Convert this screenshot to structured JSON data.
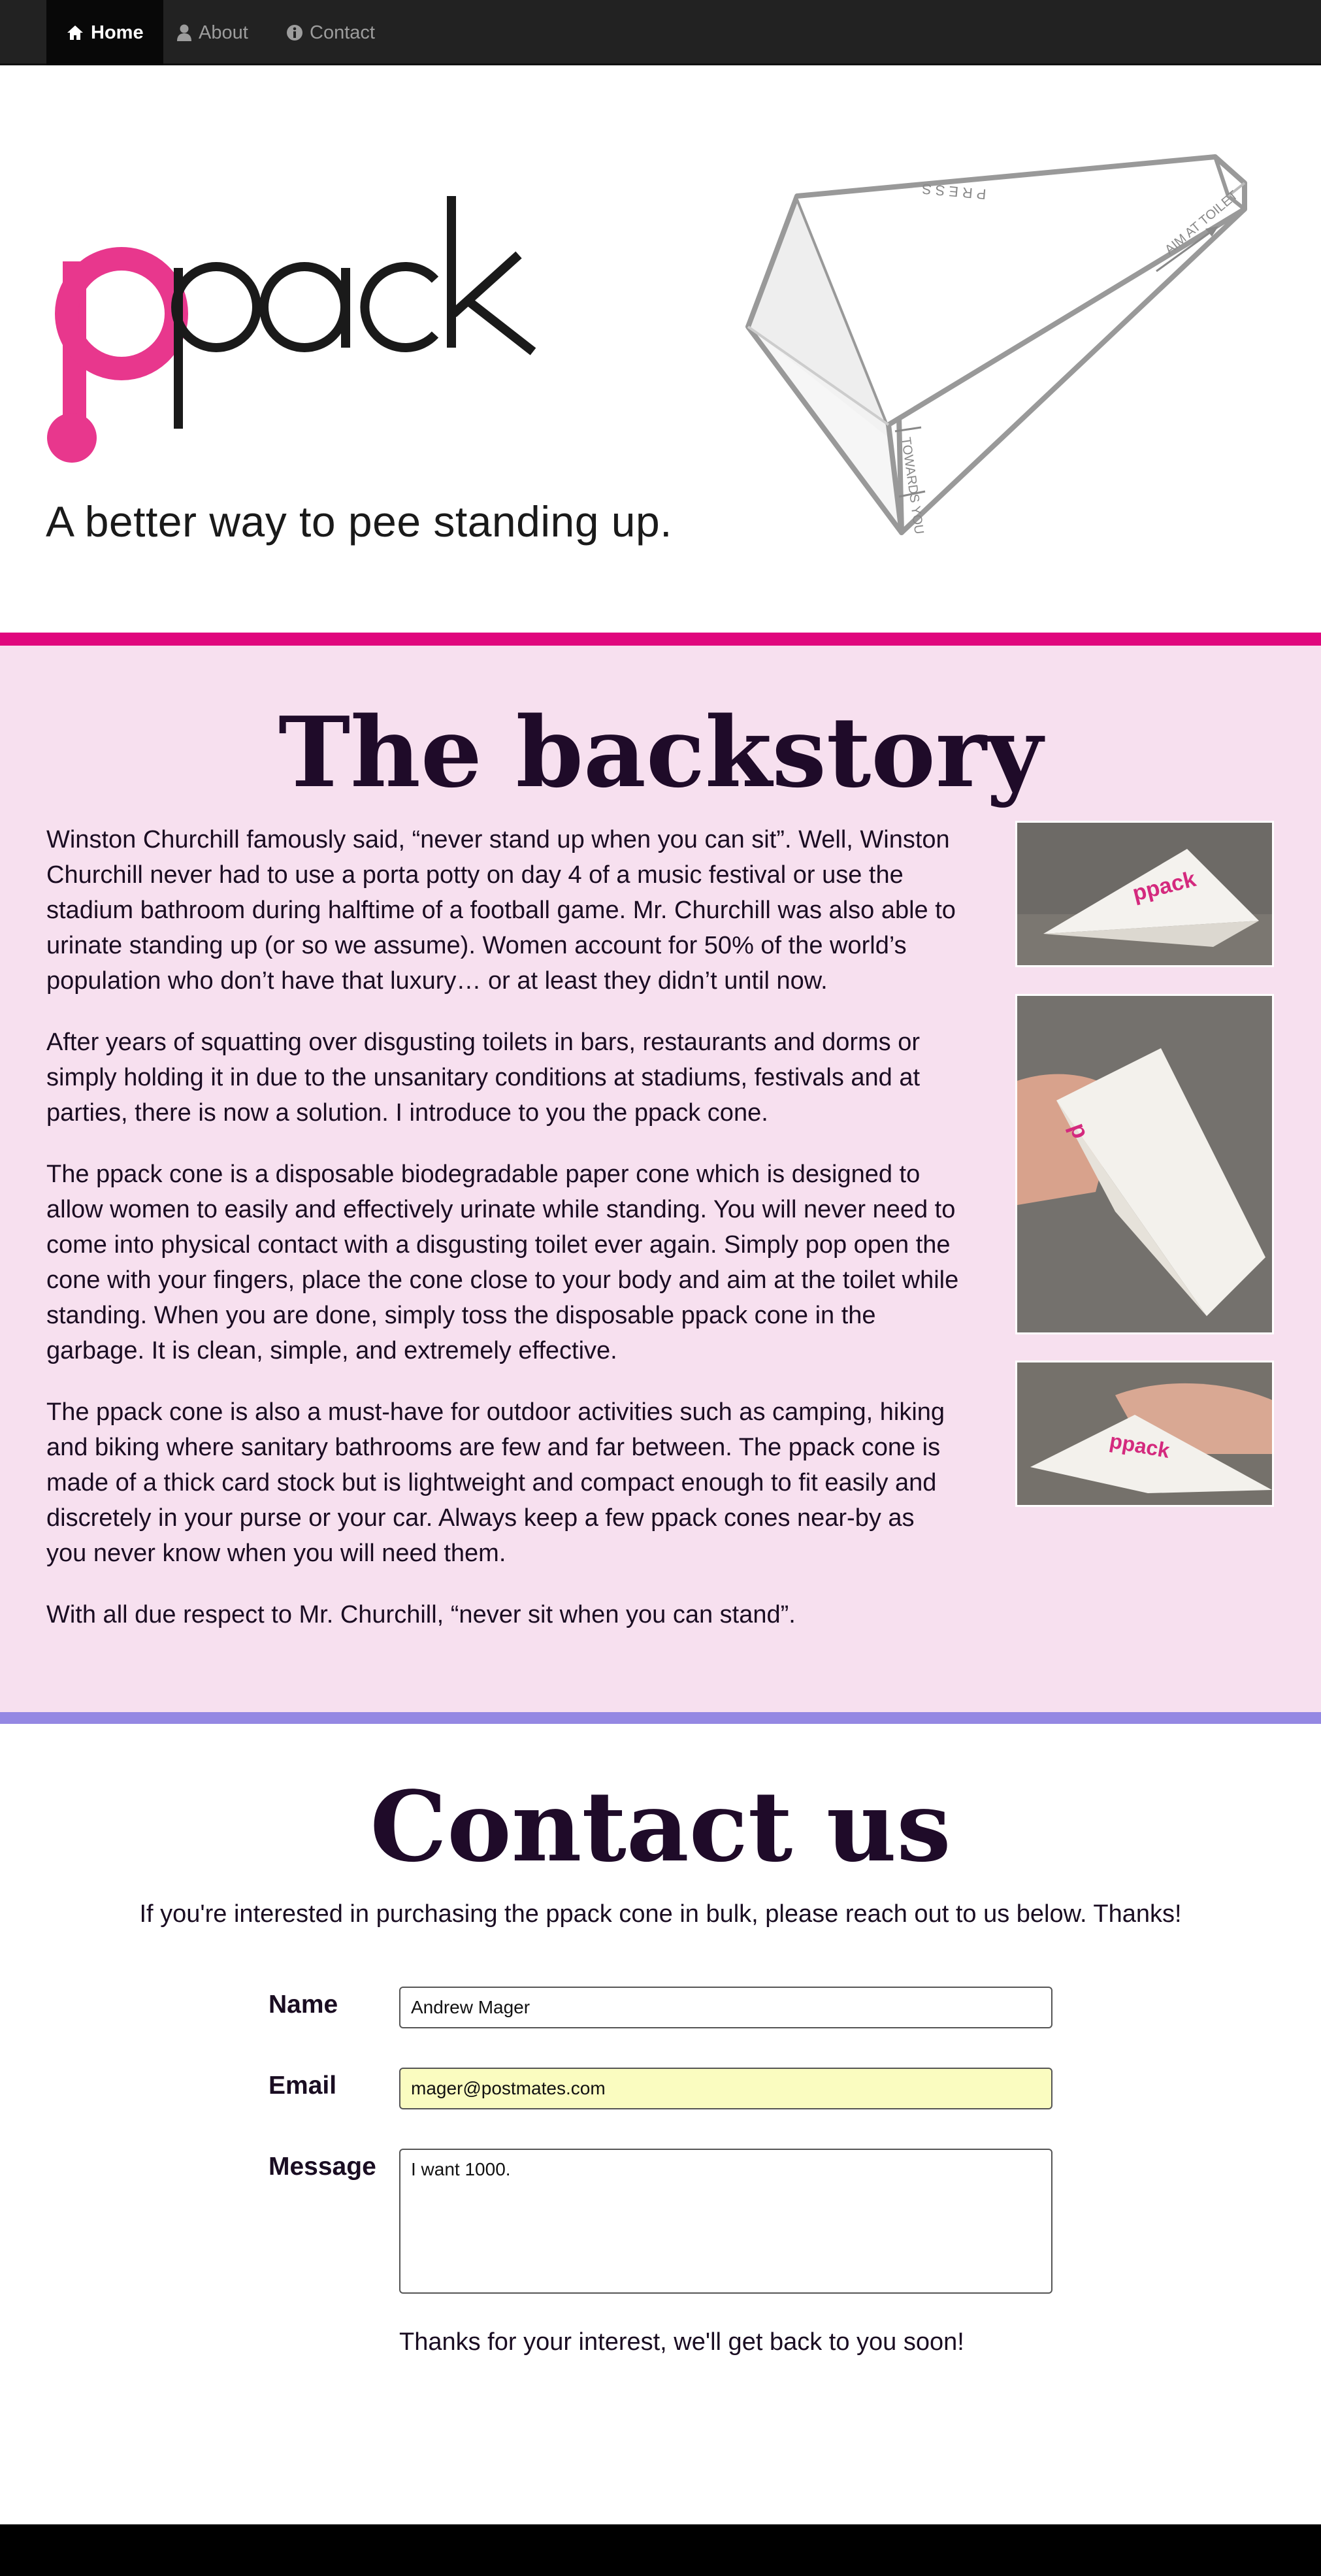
{
  "nav": {
    "items": [
      {
        "label": "Home",
        "icon": "home-icon",
        "active": true
      },
      {
        "label": "About",
        "icon": "user-icon",
        "active": false
      },
      {
        "label": "Contact",
        "icon": "info-circle-icon",
        "active": false
      }
    ]
  },
  "hero": {
    "logo_text": "ppack",
    "tagline": "A better way to pee standing up.",
    "cone_labels": {
      "press": "PRESS",
      "aim": "AIM AT TOILET",
      "towards": "TOWARDS YOU"
    }
  },
  "backstory": {
    "title": "The backstory",
    "paragraphs": [
      "Winston Churchill famously said, “never stand up when you can sit”. Well, Winston Churchill never had to use a porta potty on day 4 of a music festival or use the stadium bathroom during halftime of a football game. Mr. Churchill was also able to urinate standing up (or so we assume). Women account for 50% of the world’s population who don’t have that luxury… or at least they didn’t until now.",
      "After years of squatting over disgusting toilets in bars, restaurants and dorms or simply holding it in due to the unsanitary conditions at stadiums, festivals and at parties, there is now a solution. I introduce to you the ppack cone.",
      "The ppack cone is a disposable biodegradable paper cone which is designed to allow women to easily and effectively urinate while standing. You will never need to come into physical contact with a disgusting toilet ever again. Simply pop open the cone with your fingers, place the cone close to your body and aim at the toilet while standing. When you are done, simply toss the disposable ppack cone in the garbage. It is clean, simple, and extremely effective.",
      "The ppack cone is also a must-have for outdoor activities such as camping, hiking and biking where sanitary bathrooms are few and far between. The ppack cone is made of a thick card stock but is lightweight and compact enough to fit easily and discretely in your purse or your car. Always keep a few ppack cones near-by as you never know when you will need them.",
      "With all due respect to Mr. Churchill, “never sit when you can stand”."
    ],
    "photo_logo_text": "ppack"
  },
  "contact": {
    "title": "Contact us",
    "intro": "If you're interested in purchasing the ppack cone in bulk, please reach out to us below. Thanks!",
    "name_label": "Name",
    "name_value": "Andrew Mager",
    "email_label": "Email",
    "email_value": "mager@postmates.com",
    "message_label": "Message",
    "message_value": "I want 1000.",
    "thanks": "Thanks for your interest, we'll get back to you soon!"
  },
  "colors": {
    "brand_pink": "#e0077d",
    "backstory_bg": "#f7e0ef",
    "divider_purple": "#9488e3",
    "nav_bg": "#222222",
    "title_color": "#1f0b29"
  }
}
